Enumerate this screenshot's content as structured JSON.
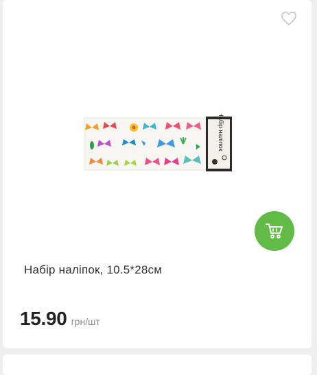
{
  "product": {
    "title": "Набір наліпок, 10.5*28см",
    "price": "15.90",
    "unit": "грн/шт",
    "image": {
      "header_text": "Набір наліпок",
      "subject": "butterfly stickers"
    }
  },
  "icons": {
    "favorite": "heart-outline-icon",
    "cart": "shopping-cart-icon"
  },
  "colors": {
    "accent": "#62bb46",
    "background": "#efefef",
    "card": "#ffffff",
    "price": "#222222",
    "unit": "#8a8a8a"
  }
}
